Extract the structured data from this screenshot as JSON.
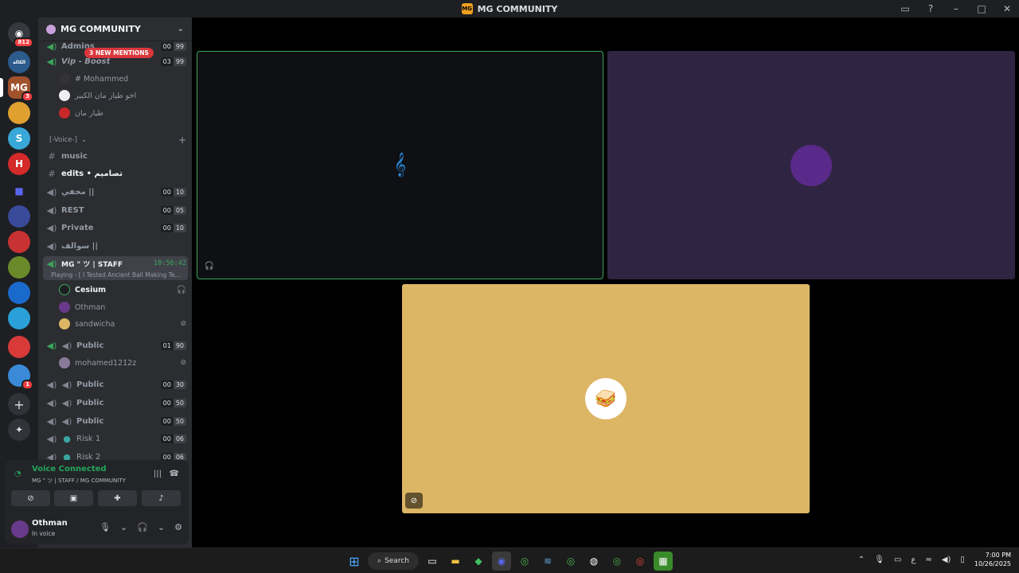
{
  "window": {
    "title": "MG COMMUNITY",
    "logo_text": "MG"
  },
  "servers": {
    "dm_badge": "812",
    "items": [
      {
        "label": "الكالة"
      },
      {
        "label": "MG",
        "badge": "3"
      },
      {
        "label": ""
      },
      {
        "label": "S"
      },
      {
        "label": "H"
      },
      {
        "label": ""
      },
      {
        "label": ""
      },
      {
        "label": ""
      },
      {
        "label": ""
      },
      {
        "label": ""
      },
      {
        "label": ""
      },
      {
        "label": "",
        "badge": "1"
      }
    ]
  },
  "guild": {
    "name": "MG COMMUNITY",
    "mention_pill": "3 NEW MENTIONS",
    "rows": [
      {
        "icon": "speaker",
        "name": "Admins",
        "c1": "00",
        "c2": "99"
      },
      {
        "icon": "speaker",
        "name": "Vip - Boost",
        "c1": "03",
        "c2": "99"
      }
    ],
    "vip_users": [
      {
        "name": "# Mohammed"
      },
      {
        "name": "اخو طيار مان الكبير"
      },
      {
        "name": "طيار مان"
      }
    ],
    "category": "[-Voice-]",
    "channels": [
      {
        "icon": "#",
        "name": "music"
      },
      {
        "icon": "#",
        "name": "edits • تصاميم"
      },
      {
        "icon": "speaker",
        "name": "مخفي ||",
        "c1": "00",
        "c2": "10"
      },
      {
        "icon": "speaker",
        "name": "REST",
        "c1": "00",
        "c2": "05"
      },
      {
        "icon": "speaker",
        "name": "Private",
        "c1": "00",
        "c2": "10"
      },
      {
        "icon": "speaker",
        "name": "سوالف ||"
      }
    ],
    "active_channel": {
      "name": "MG \" ツ | STAFF",
      "timer": "10:56:42",
      "activity": "Playing - [ I Tested Ancient Ball Making Te..."
    },
    "active_users": [
      {
        "name": "Cesium"
      },
      {
        "name": "Othman"
      },
      {
        "name": "sandwicha"
      }
    ],
    "public_channels": [
      {
        "name": "Public",
        "c1": "01",
        "c2": "90"
      },
      {
        "name": "Public",
        "c1": "00",
        "c2": "30"
      },
      {
        "name": "Public",
        "c1": "00",
        "c2": "50"
      },
      {
        "name": "Public",
        "c1": "00",
        "c2": "50"
      },
      {
        "name": "Risk 1",
        "c1": "00",
        "c2": "06"
      },
      {
        "name": "Risk 2",
        "c1": "00",
        "c2": "06"
      }
    ],
    "public_user": "mohamed1212z"
  },
  "voice": {
    "status": "Voice Connected",
    "channel_path": "MG \" ツ | STAFF / MG COMMUNITY"
  },
  "user": {
    "name": "Othman",
    "status": "In voice"
  },
  "taskbar": {
    "search_label": "Search",
    "time": "7:00 PM",
    "date": "10/26/2025"
  },
  "colors": {
    "speaking_border": "#3ba55c",
    "tile2_bg": "#2f2543",
    "tile3_bg": "#dcb565"
  }
}
